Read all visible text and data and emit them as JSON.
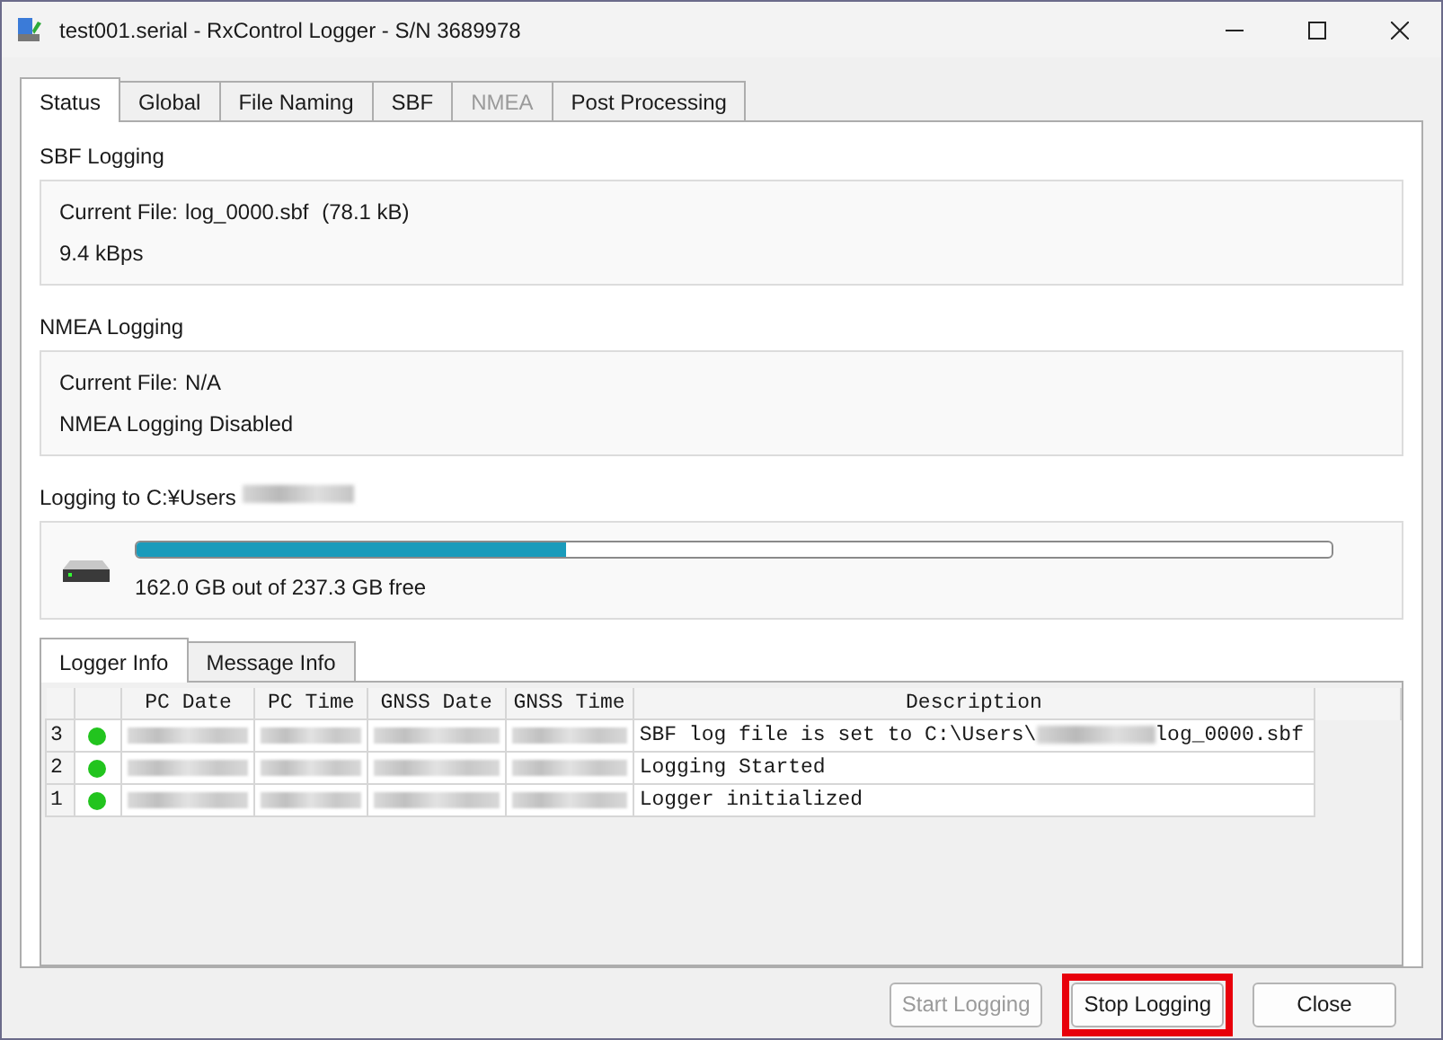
{
  "window": {
    "title": "test001.serial - RxControl Logger - S/N 3689978"
  },
  "tabs": [
    {
      "label": "Status",
      "selected": true,
      "disabled": false
    },
    {
      "label": "Global",
      "selected": false,
      "disabled": false
    },
    {
      "label": "File Naming",
      "selected": false,
      "disabled": false
    },
    {
      "label": "SBF",
      "selected": false,
      "disabled": false
    },
    {
      "label": "NMEA",
      "selected": false,
      "disabled": true
    },
    {
      "label": "Post Processing",
      "selected": false,
      "disabled": false
    }
  ],
  "sbf": {
    "title": "SBF Logging",
    "current_file_label": "Current File:",
    "current_file": "log_0000.sbf",
    "file_size": "(78.1 kB)",
    "rate": "9.4 kBps"
  },
  "nmea": {
    "title": "NMEA Logging",
    "current_file_label": "Current File:",
    "current_file": "N/A",
    "status": "NMEA Logging Disabled"
  },
  "disk": {
    "title": "Logging to C:¥Users",
    "title_redacted": true,
    "level": 0.36,
    "free_text": "162.0 GB out of 237.3 GB free"
  },
  "info_tabs": [
    {
      "label": "Logger Info",
      "selected": true
    },
    {
      "label": "Message Info",
      "selected": false
    }
  ],
  "table": {
    "columns": [
      "PC Date",
      "PC Time",
      "GNSS Date",
      "GNSS Time",
      "Description"
    ],
    "rows": [
      {
        "index": "3",
        "color": "#22c41e",
        "redacted": true,
        "description": "SBF log file is set to C:\\Users\\",
        "description_redacted": true,
        "description_end": "log_0000.sbf"
      },
      {
        "index": "2",
        "color": "#22c41e",
        "redacted": true,
        "description": "Logging Started",
        "description_redacted": false,
        "description_end": ""
      },
      {
        "index": "1",
        "color": "#22c41e",
        "redacted": true,
        "description": "Logger initialized",
        "description_redacted": false,
        "description_end": ""
      }
    ]
  },
  "buttons": [
    {
      "label": "Start Logging",
      "disabled": true,
      "highlighted": false
    },
    {
      "label": "Stop Logging",
      "disabled": false,
      "highlighted": true
    },
    {
      "label": "Close",
      "disabled": false,
      "highlighted": false
    }
  ]
}
